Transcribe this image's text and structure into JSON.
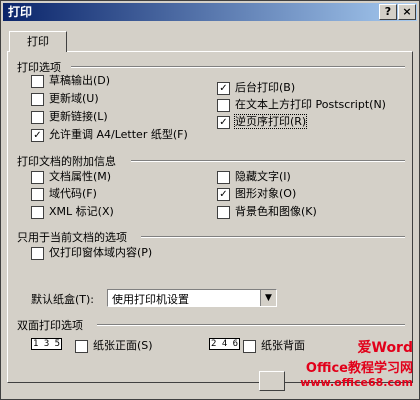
{
  "window": {
    "title": "打印",
    "help_label": "?",
    "close_label": "×"
  },
  "tab": {
    "label": "打印"
  },
  "print_options": {
    "heading": "打印选项",
    "items": [
      {
        "label": "草稿输出(D)",
        "checked": false
      },
      {
        "label": "更新域(U)",
        "checked": false
      },
      {
        "label": "更新链接(L)",
        "checked": false
      },
      {
        "label": "允许重调 A4/Letter 纸型(F)",
        "checked": true
      },
      {
        "label": "后台打印(B)",
        "checked": true
      },
      {
        "label": "在文本上方打印 Postscript(N)",
        "checked": false
      },
      {
        "label": "逆页序打印(R)",
        "checked": true
      }
    ]
  },
  "extra_info": {
    "heading": "打印文档的附加信息",
    "items": [
      {
        "label": "文档属性(M)",
        "checked": false
      },
      {
        "label": "域代码(F)",
        "checked": false
      },
      {
        "label": "XML 标记(X)",
        "checked": false
      },
      {
        "label": "隐藏文字(I)",
        "checked": false
      },
      {
        "label": "图形对象(O)",
        "checked": true
      },
      {
        "label": "背景色和图像(K)",
        "checked": false
      }
    ]
  },
  "current_doc": {
    "heading": "只用于当前文档的选项",
    "items": [
      {
        "label": "仅打印窗体域内容(P)",
        "checked": false
      }
    ]
  },
  "tray": {
    "label": "默认纸盒(T):",
    "value": "使用打印机设置",
    "arrow": "▼"
  },
  "duplex": {
    "heading": "双面打印选项",
    "front": {
      "label": "纸张正面(S)",
      "checked": false,
      "icon": "1 3 5"
    },
    "back": {
      "label": "纸张背面",
      "checked": false,
      "icon": "2 4 6"
    }
  },
  "check_mark": "✓",
  "watermark": {
    "brand": "爱Word",
    "line2": "Office教程学习网",
    "url": "www.office68.com"
  }
}
